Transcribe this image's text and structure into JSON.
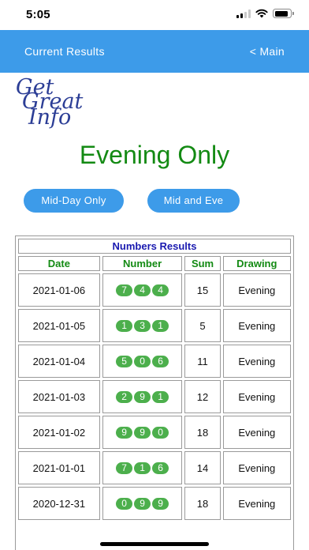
{
  "status_bar": {
    "time": "5:05",
    "icons": [
      "cellular-signal-icon",
      "wifi-icon",
      "battery-icon"
    ],
    "battery_level": 0.85
  },
  "nav": {
    "title": "Current Results",
    "back_label": "< Main"
  },
  "logo": {
    "line1": "Get",
    "line2": "Great",
    "line3": "Info"
  },
  "page_heading": "Evening Only",
  "buttons": {
    "midday": "Mid-Day Only",
    "mid_eve": "Mid and Eve"
  },
  "table": {
    "title": "Numbers Results",
    "headers": [
      "Date",
      "Number",
      "Sum",
      "Drawing"
    ],
    "rows": [
      {
        "date": "2021-01-06",
        "digits": [
          "7",
          "4",
          "4"
        ],
        "sum": "15",
        "drawing": "Evening"
      },
      {
        "date": "2021-01-05",
        "digits": [
          "1",
          "3",
          "1"
        ],
        "sum": "5",
        "drawing": "Evening"
      },
      {
        "date": "2021-01-04",
        "digits": [
          "5",
          "0",
          "6"
        ],
        "sum": "11",
        "drawing": "Evening"
      },
      {
        "date": "2021-01-03",
        "digits": [
          "2",
          "9",
          "1"
        ],
        "sum": "12",
        "drawing": "Evening"
      },
      {
        "date": "2021-01-02",
        "digits": [
          "9",
          "9",
          "0"
        ],
        "sum": "18",
        "drawing": "Evening"
      },
      {
        "date": "2021-01-01",
        "digits": [
          "7",
          "1",
          "6"
        ],
        "sum": "14",
        "drawing": "Evening"
      },
      {
        "date": "2020-12-31",
        "digits": [
          "0",
          "9",
          "9"
        ],
        "sum": "18",
        "drawing": "Evening"
      }
    ]
  },
  "colors": {
    "nav_blue": "#3d9be9",
    "heading_green": "#138a13",
    "ball_green": "#4caf4c",
    "table_title_blue": "#1a1ab0",
    "logo_blue": "#2c3e96"
  }
}
